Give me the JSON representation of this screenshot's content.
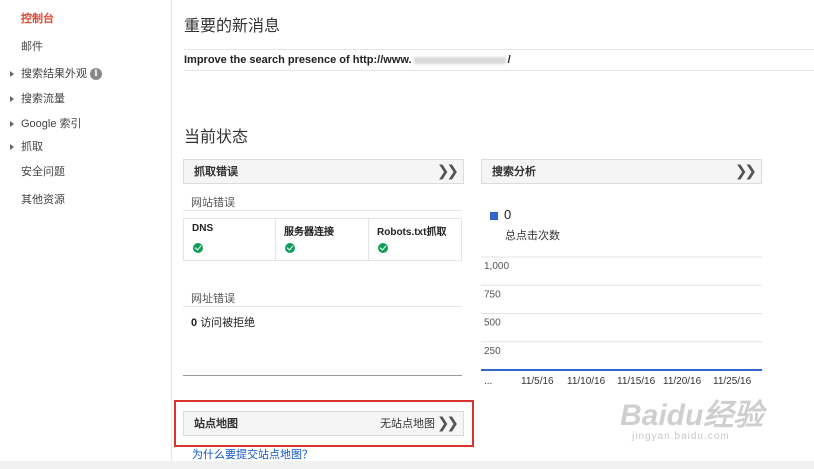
{
  "sidebar": {
    "items": [
      {
        "label": "控制台",
        "active": true,
        "expandable": false
      },
      {
        "label": "邮件",
        "active": false,
        "expandable": false
      },
      {
        "label": "搜索结果外观",
        "active": false,
        "expandable": true,
        "info": "i"
      },
      {
        "label": "搜索流量",
        "active": false,
        "expandable": true
      },
      {
        "label": "Google 索引",
        "active": false,
        "expandable": true
      },
      {
        "label": "抓取",
        "active": false,
        "expandable": true
      },
      {
        "label": "安全问题",
        "active": false,
        "expandable": false
      },
      {
        "label": "其他资源",
        "active": false,
        "expandable": false
      }
    ]
  },
  "messages": {
    "title": "重要的新消息",
    "item_prefix": "Improve the search presence of http://www.",
    "item_suffix": "/"
  },
  "status": {
    "title": "当前状态",
    "crawl_errors": {
      "title": "抓取错误",
      "site_errors_label": "网站错误",
      "columns": [
        "DNS",
        "服务器连接",
        "Robots.txt抓取"
      ],
      "url_errors_label": "网址错误",
      "url_errors_count": "0",
      "url_errors_text": "访问被拒绝"
    },
    "search_analytics": {
      "title": "搜索分析",
      "total_clicks": "0",
      "total_clicks_label": "总点击次数"
    },
    "sitemaps": {
      "title": "站点地图",
      "status": "无站点地图",
      "help_link": "为什么要提交站点地图？"
    }
  },
  "chart_data": {
    "type": "line",
    "series": [
      {
        "values": [
          0,
          0,
          0,
          0,
          0,
          0
        ]
      }
    ],
    "x": [
      "...",
      "11/5/16",
      "11/10/16",
      "11/15/16",
      "11/20/16",
      "11/25/16"
    ],
    "yticks": [
      "1,000",
      "750",
      "500",
      "250"
    ],
    "ylim": [
      0,
      1000
    ],
    "grid": true,
    "color": "#3366cc"
  },
  "watermark": {
    "brand": "Baidu经验",
    "url": "jingyan.baidu.com"
  },
  "icons": {
    "expand": "double-chevron-right-icon",
    "success": "green-check-icon",
    "info": "info-icon"
  }
}
